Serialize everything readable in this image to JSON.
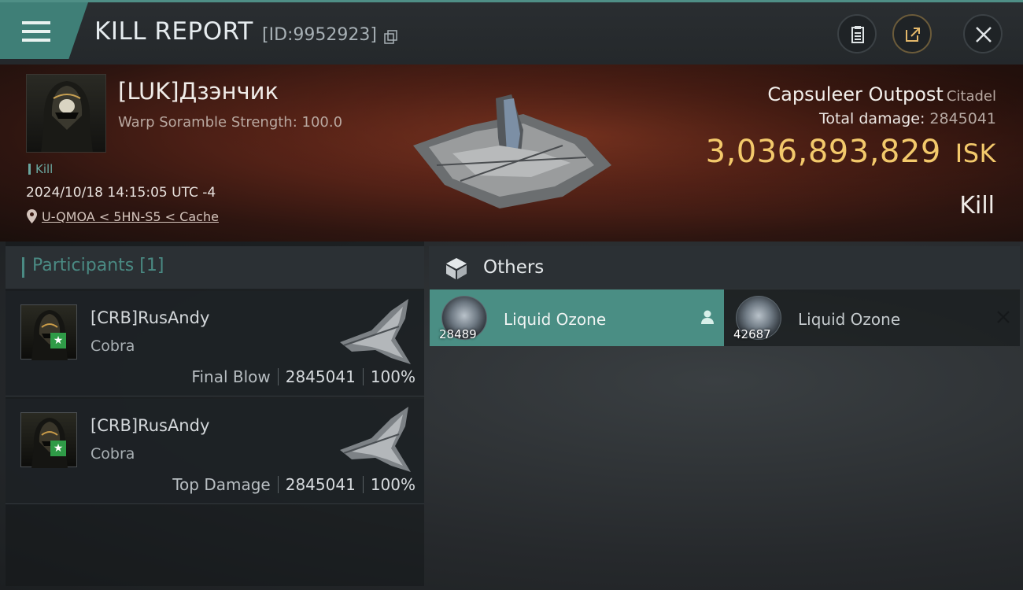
{
  "header": {
    "title": "KILL REPORT",
    "report_id": "[ID:9952923]"
  },
  "victim": {
    "name": "[LUK]Дзэнчик",
    "scramble": "Warp Soramble Strength: 100.0",
    "tag": "Kill",
    "datetime": "2024/10/18 14:15:05 UTC -4",
    "location": "U-QMOA < 5HN-S5 < Cache"
  },
  "target": {
    "name": "Capsuleer Outpost",
    "class": "Citadel",
    "total_damage_label": "Total damage:",
    "total_damage": "2845041",
    "isk_value": "3,036,893,829",
    "isk_unit": "ISK",
    "result": "Kill"
  },
  "participants": {
    "label": "Participants",
    "count": "[1]",
    "items": [
      {
        "name": "[CRB]RusAndy",
        "ship": "Cobra",
        "role": "Final Blow",
        "damage": "2845041",
        "percent": "100%"
      },
      {
        "name": "[CRB]RusAndy",
        "ship": "Cobra",
        "role": "Top Damage",
        "damage": "2845041",
        "percent": "100%"
      }
    ]
  },
  "others": {
    "label": "Others",
    "items": [
      {
        "name": "Liquid Ozone",
        "qty": "28489",
        "state": "dropped"
      },
      {
        "name": "Liquid Ozone",
        "qty": "42687",
        "state": "destroyed"
      }
    ]
  },
  "colors": {
    "accent": "#4a8e84",
    "isk": "#f3c96b",
    "banner": "#5a2418"
  },
  "icons": [
    "menu-icon",
    "copy-icon",
    "clipboard-icon",
    "share-icon",
    "close-icon",
    "location-pin-icon",
    "cube-icon",
    "person-icon",
    "x-icon"
  ]
}
